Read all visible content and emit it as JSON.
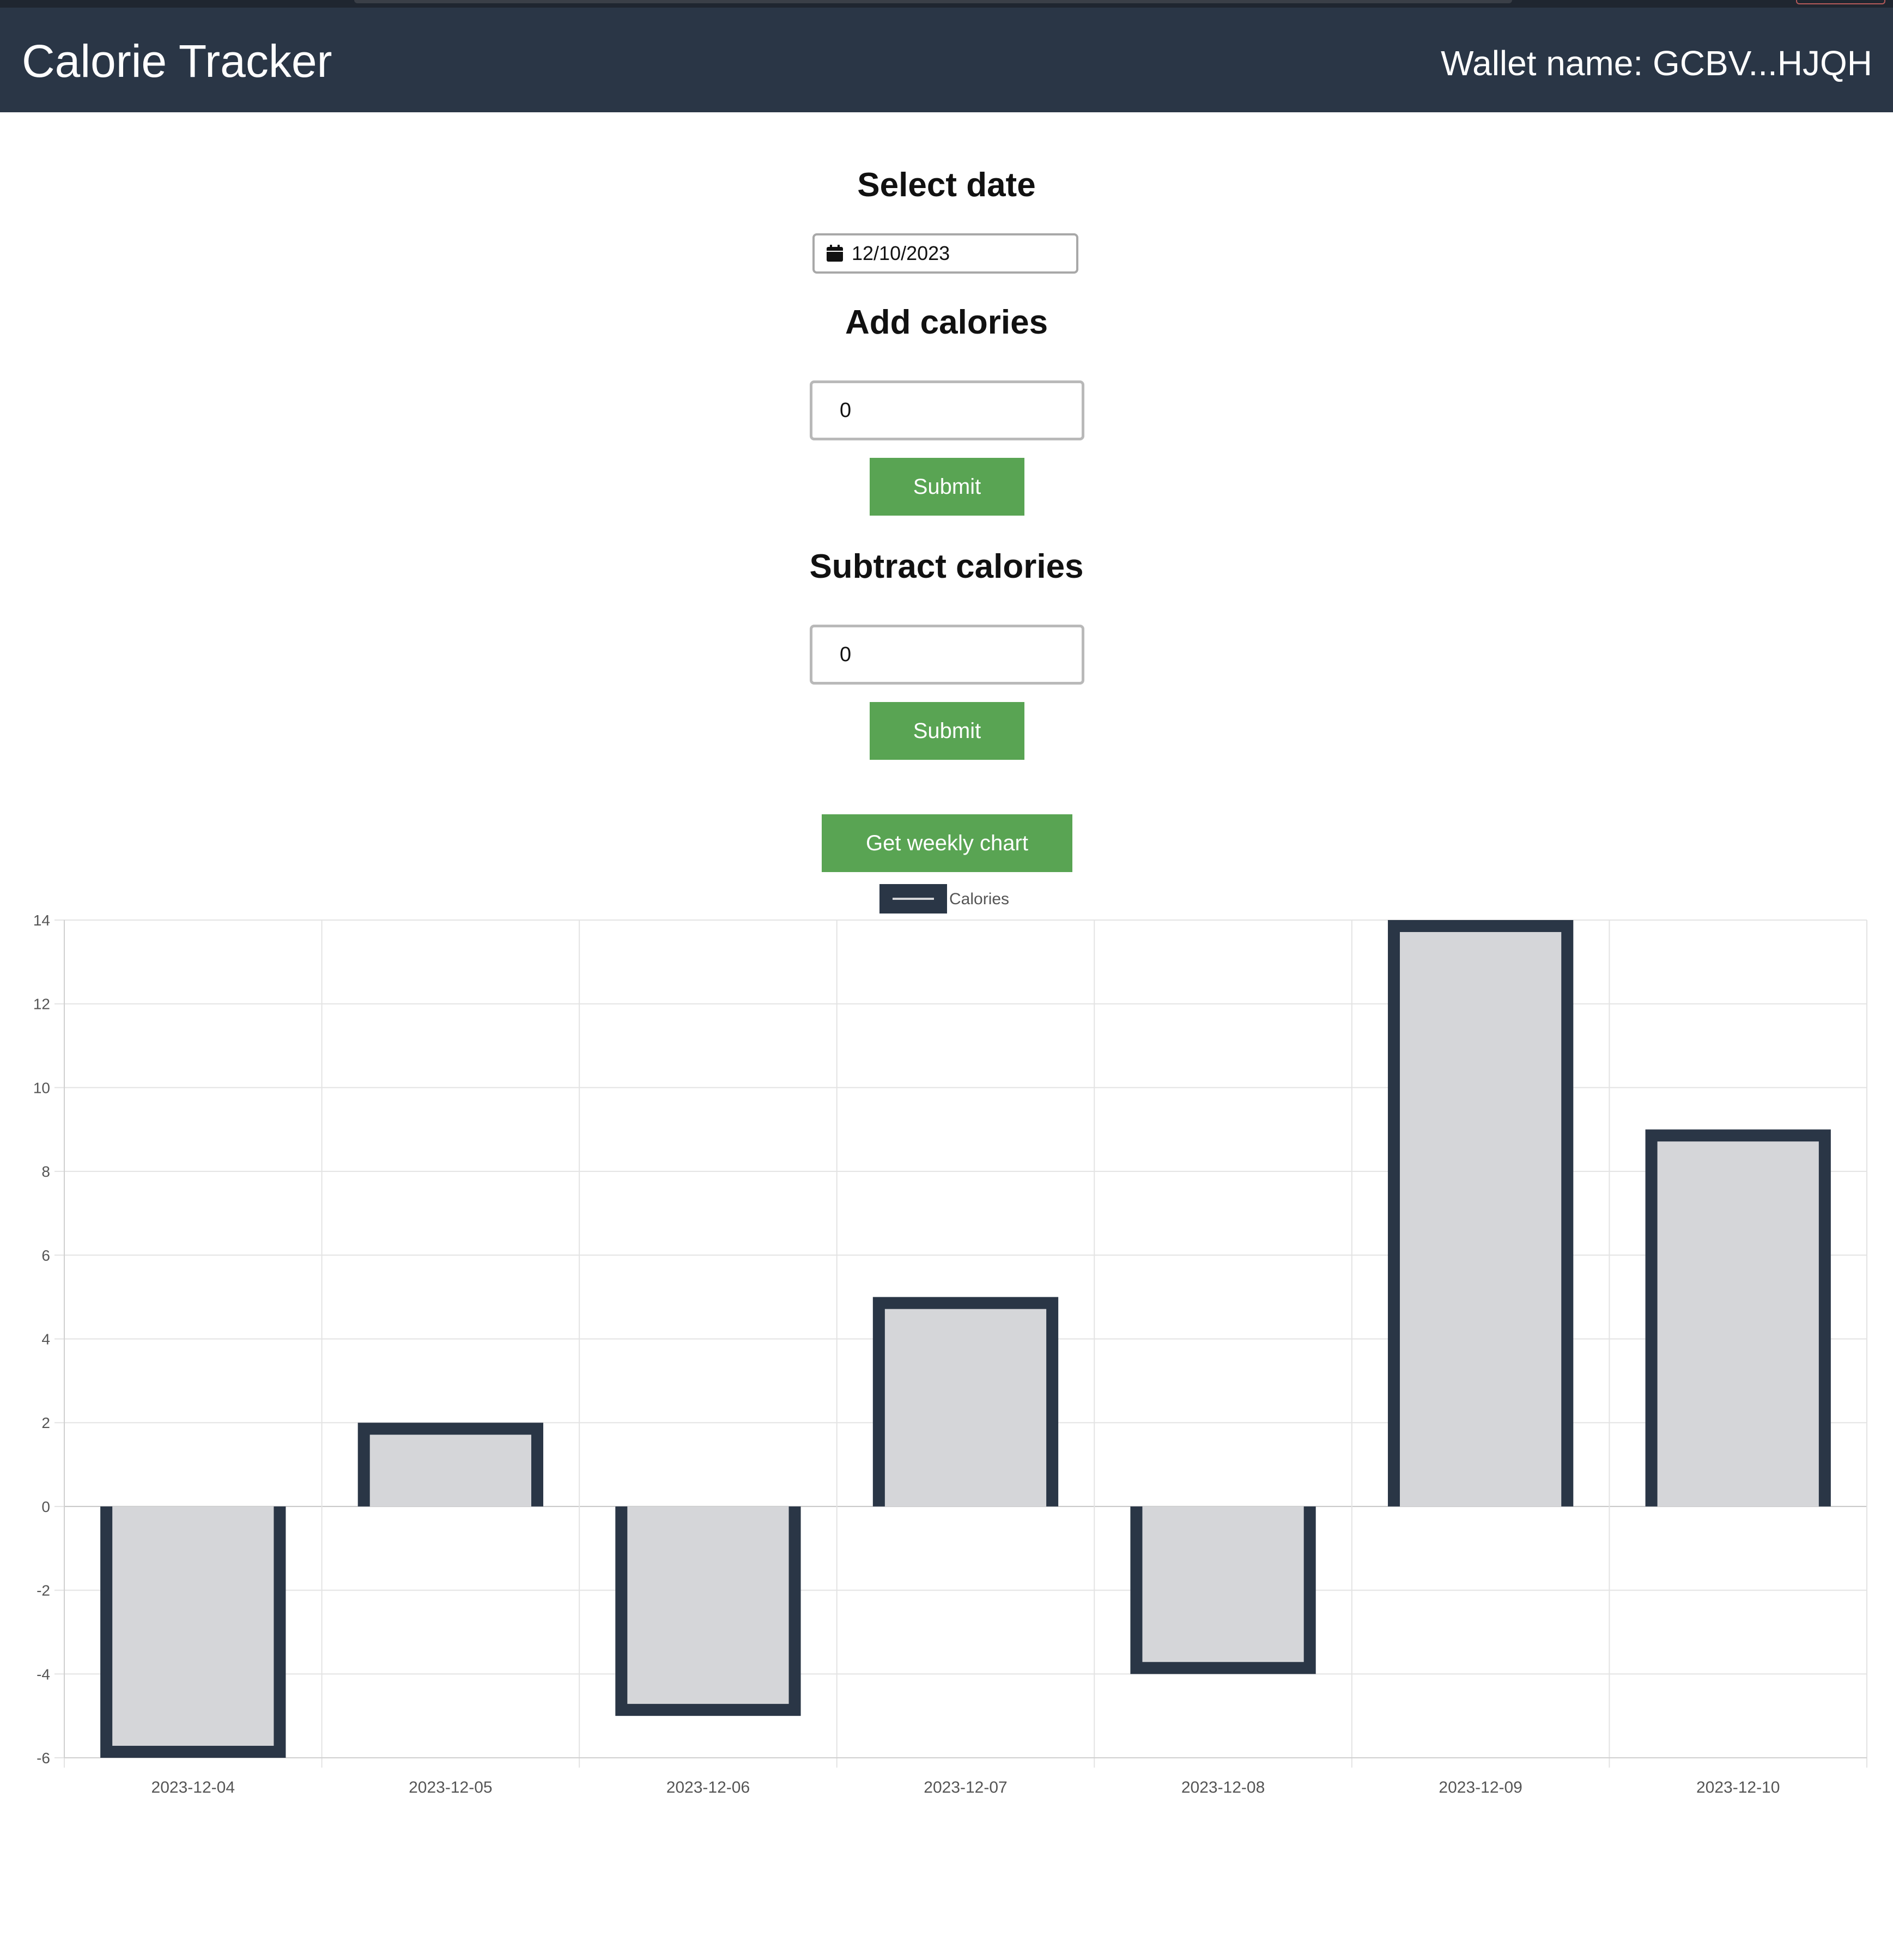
{
  "app": {
    "title": "Calorie Tracker",
    "wallet_label": "Wallet name: GCBV...HJQH"
  },
  "date_section": {
    "heading": "Select date",
    "value": "12/10/2023"
  },
  "add_section": {
    "heading": "Add calories",
    "value": "0",
    "submit_label": "Submit"
  },
  "subtract_section": {
    "heading": "Subtract calories",
    "value": "0",
    "submit_label": "Submit"
  },
  "weekly_button_label": "Get weekly chart",
  "colors": {
    "header_bg": "#2a3646",
    "button_green": "#59a453",
    "bar_fill": "#d5d6d9",
    "bar_border": "#2a3646"
  },
  "chart_data": {
    "type": "bar",
    "categories": [
      "2023-12-04",
      "2023-12-05",
      "2023-12-06",
      "2023-12-07",
      "2023-12-08",
      "2023-12-09",
      "2023-12-10"
    ],
    "series": [
      {
        "name": "Calories",
        "values": [
          -6,
          2,
          -5,
          5,
          -4,
          14,
          9
        ]
      }
    ],
    "ylim": [
      -6,
      14
    ],
    "yticks": [
      14,
      12,
      10,
      8,
      6,
      4,
      2,
      0,
      -2,
      -4,
      -6
    ],
    "legend_position": "top-center",
    "grid": true
  }
}
